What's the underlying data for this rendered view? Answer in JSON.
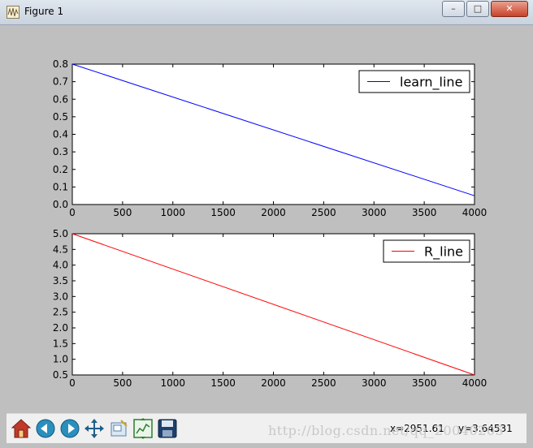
{
  "window": {
    "title": "Figure 1",
    "minimize_glyph": "–",
    "maximize_glyph": "□",
    "close_glyph": "✕"
  },
  "chart_data": [
    {
      "type": "line",
      "series": [
        {
          "name": "learn_line",
          "color": "#0000ff",
          "x": [
            0,
            4000
          ],
          "y": [
            0.8,
            0.05
          ]
        }
      ],
      "xlim": [
        0,
        4000
      ],
      "ylim": [
        0.0,
        0.8
      ],
      "xticks": [
        "0",
        "500",
        "1000",
        "1500",
        "2000",
        "2500",
        "3000",
        "3500",
        "4000"
      ],
      "yticks": [
        "0.0",
        "0.1",
        "0.2",
        "0.3",
        "0.4",
        "0.5",
        "0.6",
        "0.7",
        "0.8"
      ],
      "legend_position": "top-right",
      "grid": false
    },
    {
      "type": "line",
      "series": [
        {
          "name": "R_line",
          "color": "#ff0000",
          "x": [
            0,
            4000
          ],
          "y": [
            5.0,
            0.5
          ]
        }
      ],
      "xlim": [
        0,
        4000
      ],
      "ylim": [
        0.5,
        5.0
      ],
      "xticks": [
        "0",
        "500",
        "1000",
        "1500",
        "2000",
        "2500",
        "3000",
        "3500",
        "4000"
      ],
      "yticks": [
        "0.5",
        "1.0",
        "1.5",
        "2.0",
        "2.5",
        "3.0",
        "3.5",
        "4.0",
        "4.5",
        "5.0"
      ],
      "legend_position": "top-right",
      "grid": false
    }
  ],
  "toolbar": {
    "buttons": [
      {
        "icon": "home-icon"
      },
      {
        "icon": "back-arrow-icon"
      },
      {
        "icon": "forward-arrow-icon"
      },
      {
        "icon": "pan-move-icon"
      },
      {
        "icon": "zoom-rect-icon"
      },
      {
        "icon": "configure-subplots-icon"
      },
      {
        "icon": "save-disk-icon"
      }
    ],
    "coord_x": "x=2951.61",
    "coord_y": "y=3.64531"
  },
  "watermark": "http://blog.csdn.net/qq_20040205"
}
